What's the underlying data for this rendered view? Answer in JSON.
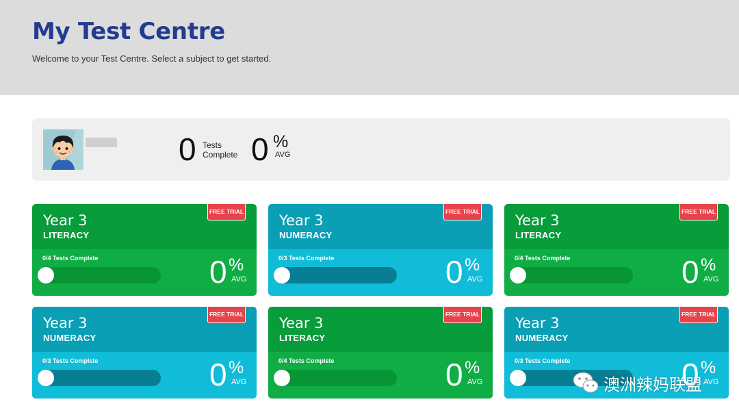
{
  "header": {
    "title": "My Test Centre",
    "subtitle": "Welcome to your Test Centre. Select a subject to get started."
  },
  "profile": {
    "tests_complete_value": "0",
    "tests_label_1": "Tests",
    "tests_label_2": "Complete",
    "avg_value": "0",
    "avg_percent": "%",
    "avg_label": "AVG"
  },
  "cards": [
    {
      "year": "Year 3",
      "subject": "LITERACY",
      "badge": "FREE TRIAL",
      "tests": "0/4 Tests Complete",
      "progress": 0,
      "pct": "0",
      "pct_sym": "%",
      "avg": "AVG",
      "theme": "green"
    },
    {
      "year": "Year 3",
      "subject": "NUMERACY",
      "badge": "FREE TRIAL",
      "tests": "0/3 Tests Complete",
      "progress": 0,
      "pct": "0",
      "pct_sym": "%",
      "avg": "AVG",
      "theme": "teal"
    },
    {
      "year": "Year 3",
      "subject": "LITERACY",
      "badge": "FREE TRIAL",
      "tests": "0/4 Tests Complete",
      "progress": 0,
      "pct": "0",
      "pct_sym": "%",
      "avg": "AVG",
      "theme": "green"
    },
    {
      "year": "Year 3",
      "subject": "NUMERACY",
      "badge": "FREE TRIAL",
      "tests": "0/3 Tests Complete",
      "progress": 0,
      "pct": "0",
      "pct_sym": "%",
      "avg": "AVG",
      "theme": "teal"
    },
    {
      "year": "Year 3",
      "subject": "LITERACY",
      "badge": "FREE TRIAL",
      "tests": "0/4 Tests Complete",
      "progress": 0,
      "pct": "0",
      "pct_sym": "%",
      "avg": "AVG",
      "theme": "green"
    },
    {
      "year": "Year 3",
      "subject": "NUMERACY",
      "badge": "FREE TRIAL",
      "tests": "0/3 Tests Complete",
      "progress": 0,
      "pct": "0",
      "pct_sym": "%",
      "avg": "AVG",
      "theme": "teal"
    }
  ],
  "watermark": {
    "icon": "wechat-icon",
    "text": "澳洲辣妈联盟"
  },
  "colors": {
    "title": "#233c8f",
    "green": "#089c3a",
    "teal": "#0b9fb5",
    "badge": "#e8424a"
  }
}
